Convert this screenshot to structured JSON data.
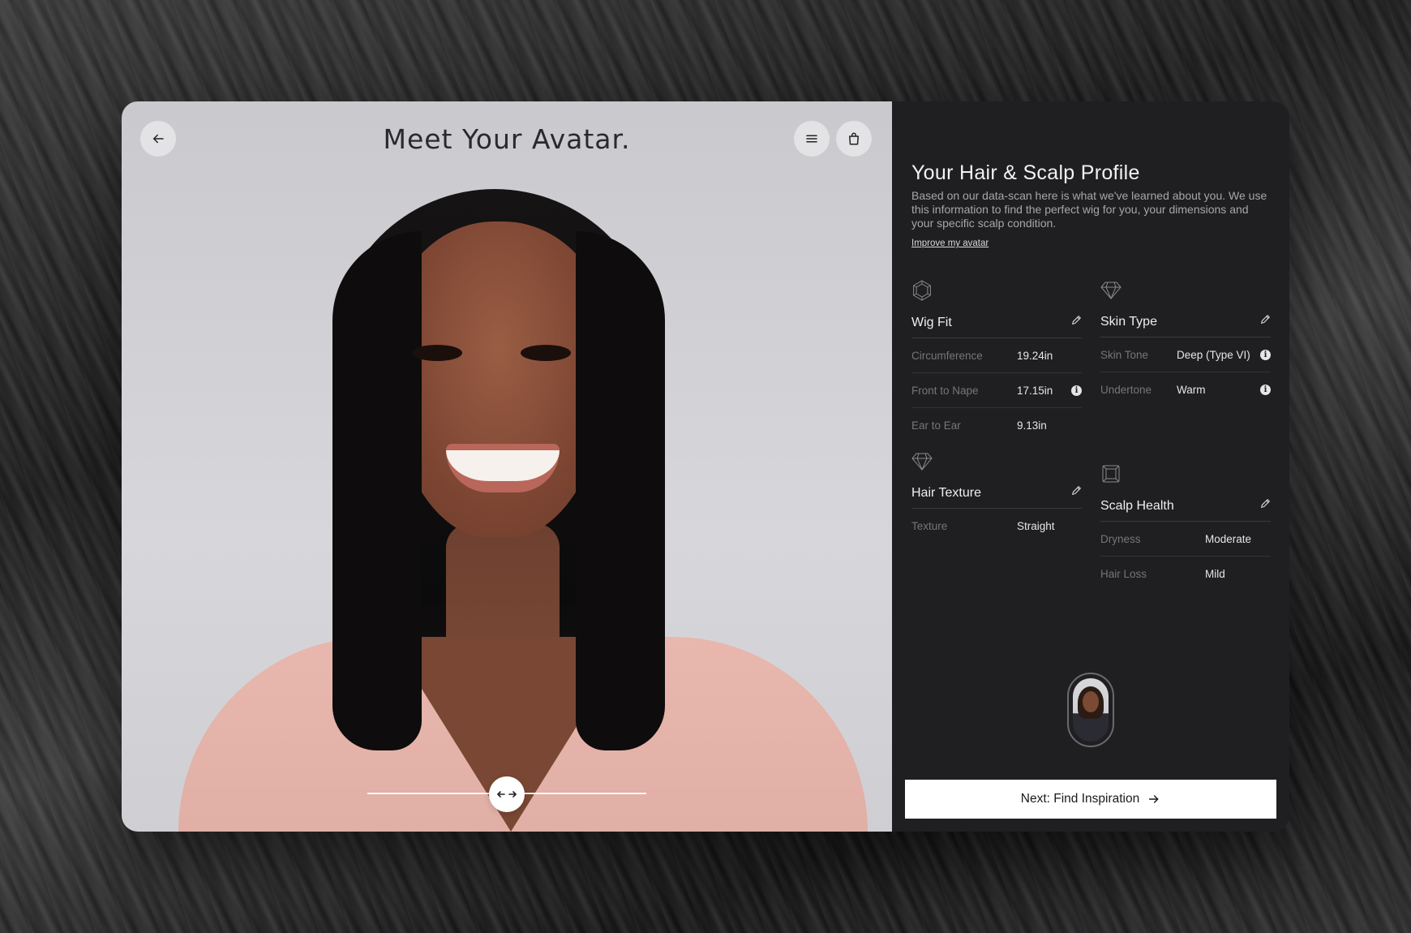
{
  "avatar": {
    "title": "Meet Your Avatar."
  },
  "profile": {
    "title": "Your Hair & Scalp Profile",
    "description": "Based on our data-scan here is what we've learned about you. We use this information to find the perfect wig for you, your dimensions and your specific scalp condition.",
    "improve_link": "Improve my avatar",
    "wig_fit": {
      "label": "Wig Fit",
      "rows": [
        {
          "key": "Circumference",
          "value": "19.24in"
        },
        {
          "key": "Front to Nape",
          "value": "17.15in"
        },
        {
          "key": "Ear to Ear",
          "value": "9.13in"
        }
      ]
    },
    "skin_type": {
      "label": "Skin Type",
      "rows": [
        {
          "key": "Skin Tone",
          "value": "Deep (Type VI)"
        },
        {
          "key": "Undertone",
          "value": "Warm"
        }
      ]
    },
    "hair_texture": {
      "label": "Hair Texture",
      "rows": [
        {
          "key": "Texture",
          "value": "Straight"
        }
      ]
    },
    "scalp_health": {
      "label": "Scalp Health",
      "rows": [
        {
          "key": "Dryness",
          "value": "Moderate"
        },
        {
          "key": "Hair Loss",
          "value": "Mild"
        }
      ]
    },
    "next_button": "Next: Find Inspiration"
  },
  "icons": {
    "back": "arrow-left-icon",
    "menu": "hamburger-menu-icon",
    "bag": "shopping-bag-icon",
    "slider": "compare-arrows-icon",
    "edit": "pencil-icon",
    "info": "info-icon",
    "next": "arrow-right-icon"
  },
  "colors": {
    "panel_bg": "#1f1f21",
    "button_bg": "#ffffff",
    "muted_text": "#76767a"
  }
}
